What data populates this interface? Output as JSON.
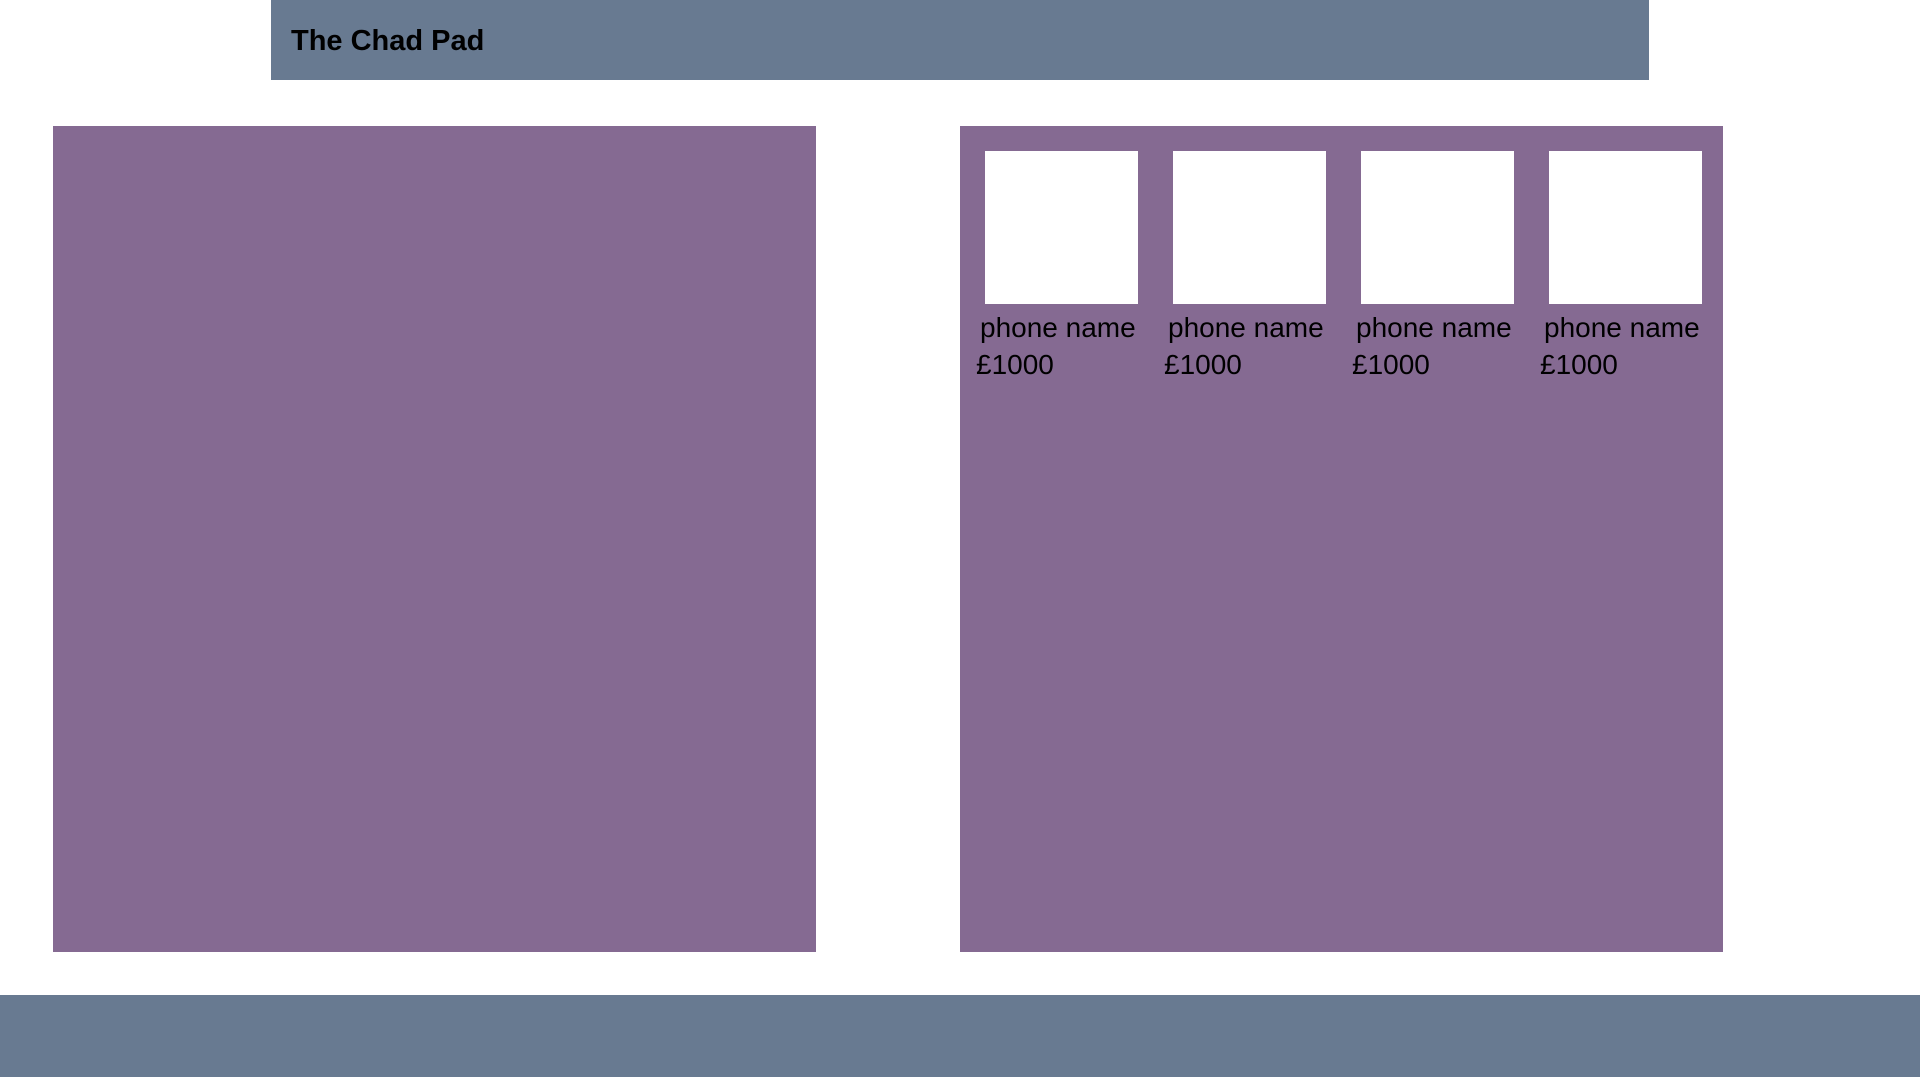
{
  "header": {
    "title": "The Chad Pad",
    "background": "#687a91"
  },
  "panels": {
    "background": "#856a92"
  },
  "products": [
    {
      "name": "phone name",
      "price": "£1000"
    },
    {
      "name": "phone name",
      "price": "£1000"
    },
    {
      "name": "phone name",
      "price": "£1000"
    },
    {
      "name": "phone name",
      "price": "£1000"
    }
  ],
  "footer": {
    "background": "#687a91"
  }
}
